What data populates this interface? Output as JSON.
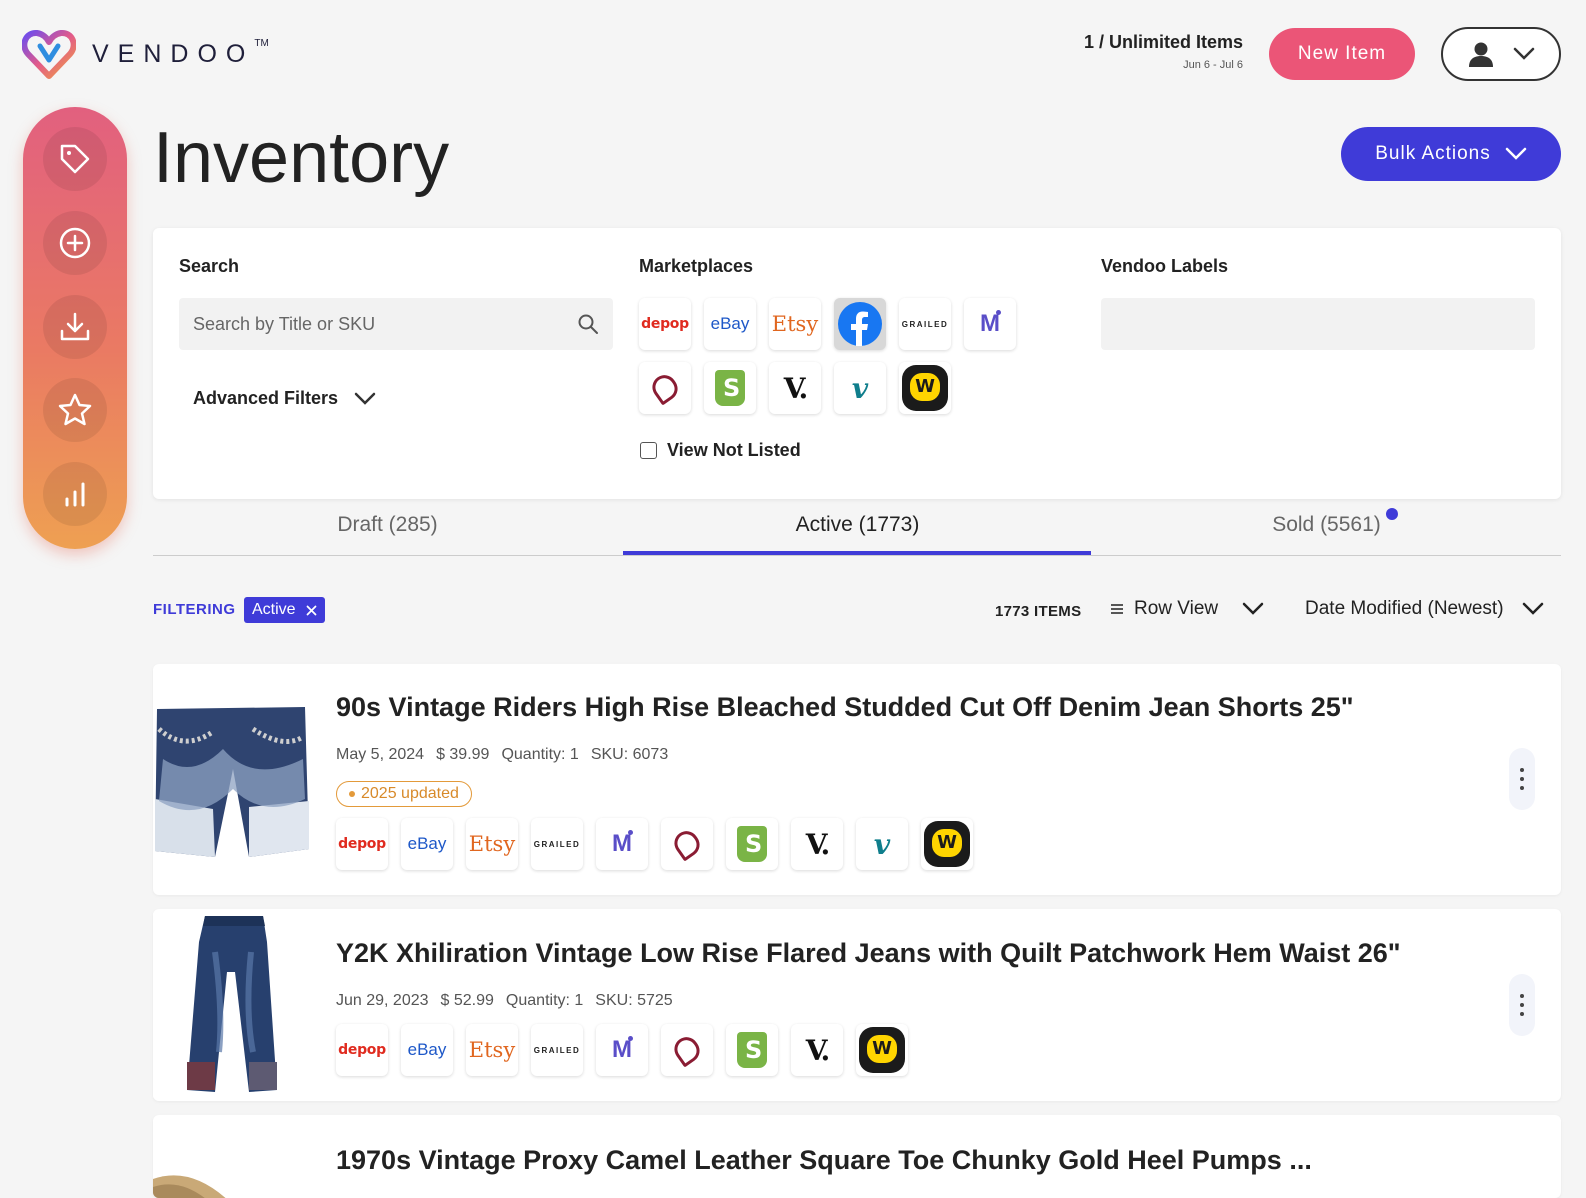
{
  "brand": {
    "name": "VENDOO",
    "tm": "TM"
  },
  "plan": {
    "title": "1 / Unlimited Items",
    "range": "Jun 6 - Jul 6"
  },
  "header": {
    "new_item": "New Item"
  },
  "page": {
    "title": "Inventory",
    "bulk_actions": "Bulk Actions"
  },
  "filters": {
    "search_label": "Search",
    "search_placeholder": "Search by Title or SKU",
    "advanced_filters": "Advanced Filters",
    "marketplaces_label": "Marketplaces",
    "view_not_listed": "View Not Listed",
    "labels_label": "Vendoo Labels",
    "marketplaces": [
      "depop",
      "eBay",
      "Etsy",
      "Facebook",
      "GRAILED",
      "Mercari",
      "Poshmark",
      "Shopify",
      "Vestiaire",
      "Vinted",
      "Whatnot"
    ],
    "selected_marketplace": "Facebook"
  },
  "tabs": [
    {
      "label": "Draft (285)"
    },
    {
      "label": "Active (1773)"
    },
    {
      "label": "Sold (5561)"
    }
  ],
  "active_tab": "Active (1773)",
  "list_controls": {
    "filtering_label": "FILTERING",
    "chip": "Active",
    "items_count": "1773 ITEMS",
    "view": "Row View",
    "sort": "Date Modified (Newest)"
  },
  "items": [
    {
      "title": "90s Vintage Riders High Rise Bleached Studded Cut Off Denim Jean Shorts 25\"",
      "date": "May 5, 2024",
      "price": "$ 39.99",
      "quantity": "Quantity: 1",
      "sku": "SKU: 6073",
      "tag": "2025 updated",
      "marketplaces": [
        "depop",
        "eBay",
        "Etsy",
        "GRAILED",
        "Mercari",
        "Poshmark",
        "Shopify",
        "Vestiaire",
        "Vinted",
        "Whatnot"
      ]
    },
    {
      "title": "Y2K Xhiliration Vintage Low Rise Flared Jeans with Quilt Patchwork Hem Waist 26\"",
      "date": "Jun 29, 2023",
      "price": "$ 52.99",
      "quantity": "Quantity: 1",
      "sku": "SKU: 5725",
      "marketplaces": [
        "depop",
        "eBay",
        "Etsy",
        "GRAILED",
        "Mercari",
        "Poshmark",
        "Shopify",
        "Vestiaire",
        "Whatnot"
      ]
    },
    {
      "title": "1970s Vintage Proxy Camel Leather Square Toe Chunky Gold Heel Pumps ..."
    }
  ],
  "colors": {
    "accent": "#3f3bd8",
    "new_item": "#eb5577",
    "sidebar_top": "#e2607f",
    "sidebar_bottom": "#eea052"
  }
}
